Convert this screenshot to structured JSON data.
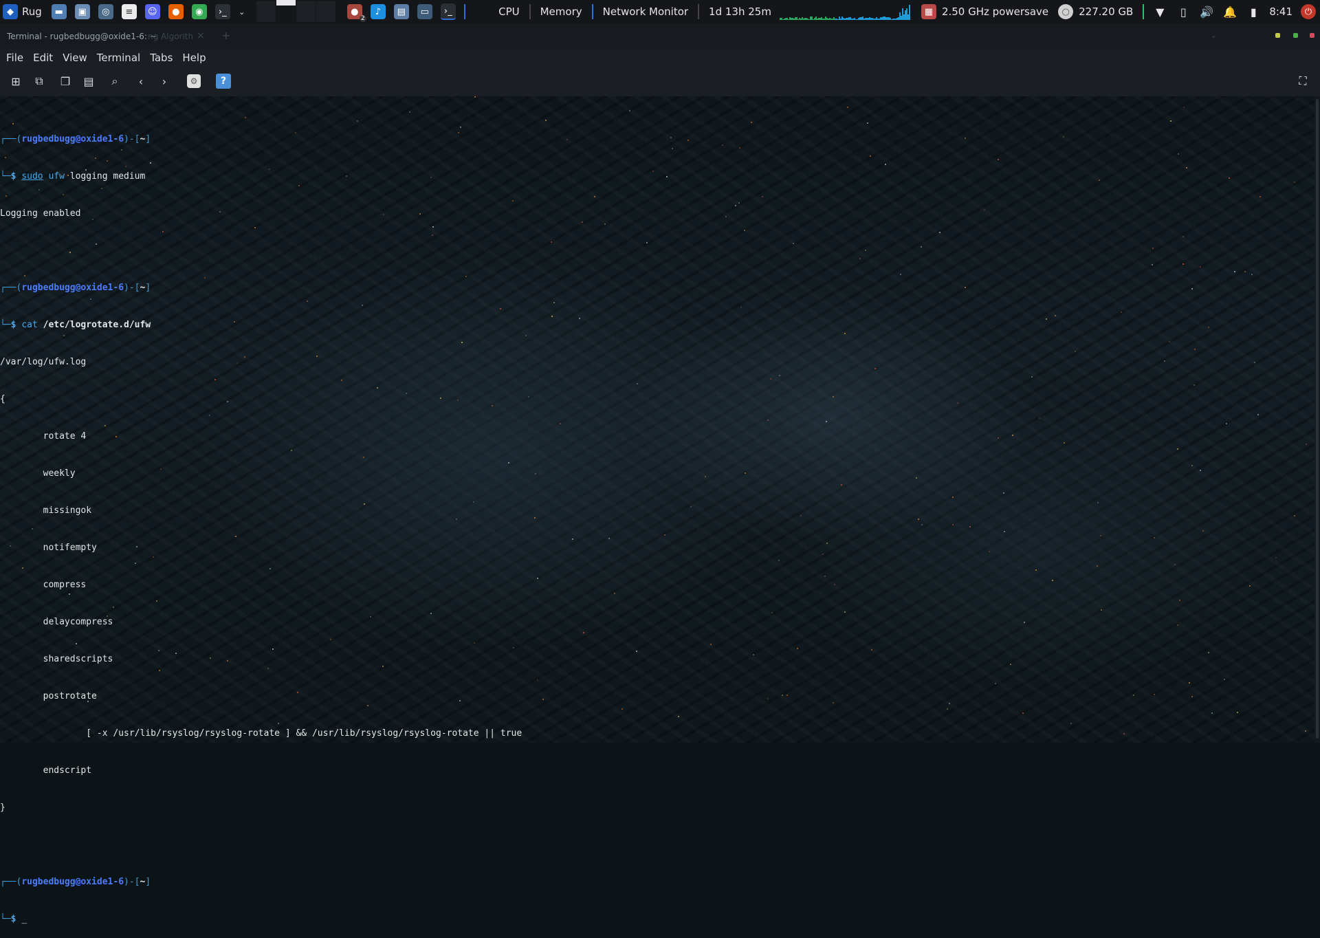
{
  "panel": {
    "launcher_label": "Rug",
    "cpu_label": "CPU",
    "memory_label": "Memory",
    "network_label": "Network Monitor",
    "uptime": "1d 13h 25m",
    "cpu_freq": "2.50 GHz powersave",
    "disk_free": "227.20 GB",
    "clock": "8:41",
    "badge_count": "2",
    "accent_color": "#2e6fd8"
  },
  "window": {
    "title": "Terminal - rugbedbugg@oxide1-6: ~",
    "ghost_tab": "ng Algorith"
  },
  "menu": [
    "File",
    "Edit",
    "View",
    "Terminal",
    "Tabs",
    "Help"
  ],
  "terminal": {
    "prompt_user": "rugbedbugg@oxide1-6",
    "prompt_path": "~",
    "cmd1_kw": "sudo",
    "cmd1_arg": "ufw",
    "cmd1_rest": " logging medium",
    "out1": "Logging enabled",
    "cmd2_kw": "cat",
    "cmd2_rest": " /etc/logrotate.d/ufw",
    "cat_output": [
      "/var/log/ufw.log",
      "{",
      "        rotate 4",
      "        weekly",
      "        missingok",
      "        notifempty",
      "        compress",
      "        delaycompress",
      "        sharedscripts",
      "        postrotate",
      "                [ -x /usr/lib/rsyslog/rsyslog-rotate ] && /usr/lib/rsyslog/rsyslog-rotate || true",
      "        endscript",
      "}"
    ],
    "cursor": "_"
  }
}
